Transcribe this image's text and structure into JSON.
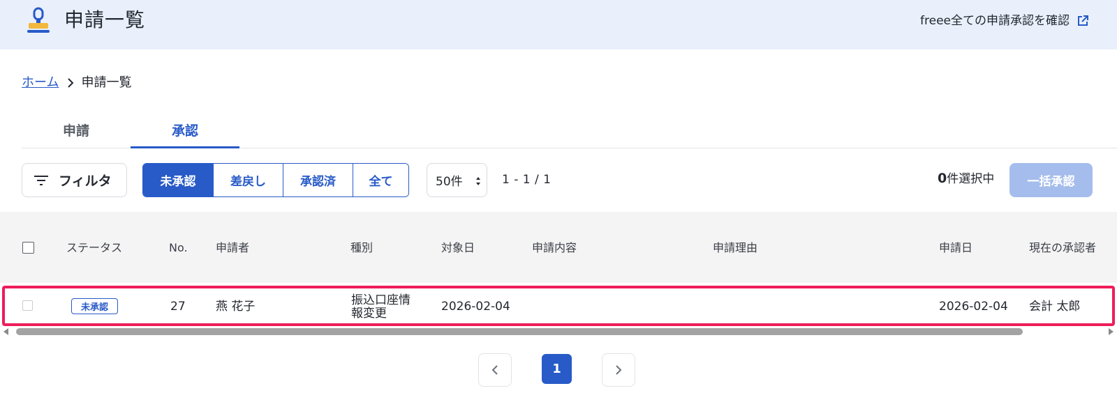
{
  "header": {
    "title": "申請一覧",
    "logo_icon": "stamp-icon",
    "external_link": "freee全ての申請承認を確認",
    "external_icon": "external-link-icon"
  },
  "breadcrumb": {
    "home": "ホーム",
    "current": "申請一覧"
  },
  "tabs": [
    {
      "label": "申請",
      "active": false
    },
    {
      "label": "承認",
      "active": true
    }
  ],
  "toolbar": {
    "filter_label": "フィルタ",
    "status_filters": [
      "未承認",
      "差戻し",
      "承認済",
      "全て"
    ],
    "active_status": "未承認",
    "per_page": "50件",
    "range": "1 - 1 / 1",
    "selected_count": "0",
    "selected_suffix": "件選択中",
    "bulk_approve": "一括承認"
  },
  "table": {
    "columns": [
      "ステータス",
      "No.",
      "申請者",
      "種別",
      "対象日",
      "申請内容",
      "申請理由",
      "申請日",
      "現在の承認者"
    ],
    "rows": [
      {
        "status": "未承認",
        "no": "27",
        "applicant": "燕 花子",
        "type_line1": "振込口座情",
        "type_line2": "報変更",
        "target_date": "2026-02-04",
        "content": "",
        "reason": "",
        "applied_date": "2026-02-04",
        "approver": "会計 太郎"
      }
    ]
  },
  "pagination": {
    "current": "1"
  },
  "colors": {
    "accent": "#285ac8",
    "header_bg": "#e9f0fb",
    "highlight": "#ee1d5a",
    "bulk_disabled": "#a5bdec"
  }
}
